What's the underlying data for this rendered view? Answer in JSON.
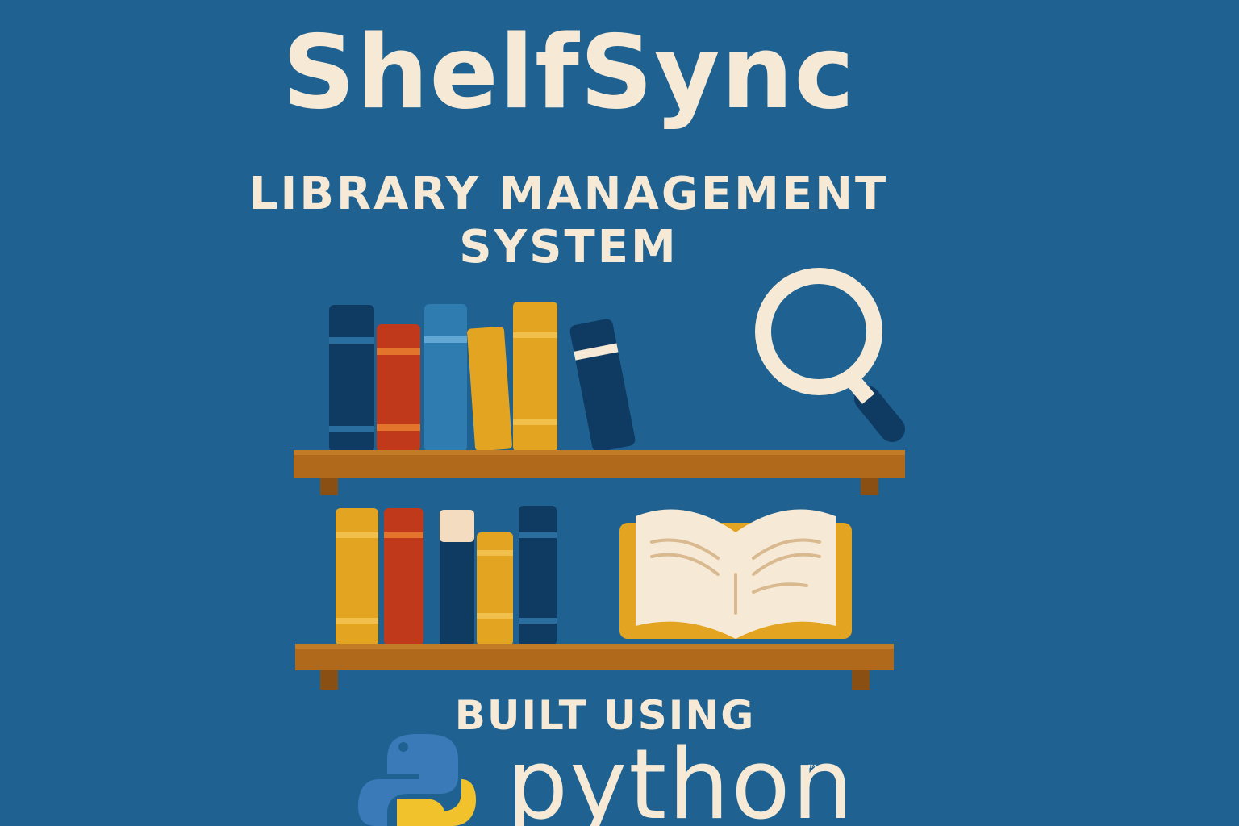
{
  "poster": {
    "title": "ShelfSync",
    "subtitle_line1": "LIBRARY MANAGEMENT",
    "subtitle_line2": "SYSTEM",
    "built_label": "BUILT USING",
    "python_wordmark": "python",
    "trademark": "™"
  },
  "icons": {
    "magnifier": "magnifying-glass-icon",
    "open_book": "open-book-icon",
    "python_logo": "python-logo-icon"
  },
  "colors": {
    "background": "#1f6291",
    "cream": "#f6ead6",
    "navy": "#0f3a62",
    "red": "#c0391b",
    "blue": "#2f7cb0",
    "gold": "#e3a521",
    "wood": "#b0691b"
  }
}
